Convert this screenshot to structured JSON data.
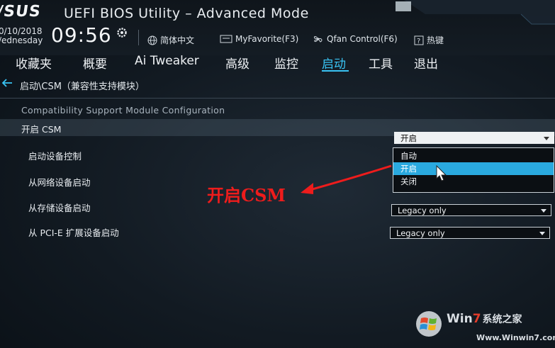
{
  "header": {
    "logo_text": "/SUS",
    "title": "UEFI BIOS Utility – Advanced Mode",
    "date": "0/10/2018",
    "weekday": "/ednesday",
    "time": "09:56",
    "tools": [
      {
        "label": "简体中文",
        "icon": "globe-icon"
      },
      {
        "label": "MyFavorite(F3)",
        "icon": "favorite-icon"
      },
      {
        "label": "Qfan Control(F6)",
        "icon": "fan-icon"
      },
      {
        "label": "热键",
        "icon": "help-icon"
      }
    ]
  },
  "nav": {
    "tabs": [
      "收藏夹",
      "概要",
      "Ai Tweaker",
      "高级",
      "监控",
      "启动",
      "工具",
      "退出"
    ],
    "active": "启动"
  },
  "breadcrumb": "启动\\CSM（兼容性支持模块）",
  "section_title": "Compatibility Support Module Configuration",
  "settings": [
    {
      "label": "开启 CSM",
      "value": "开启",
      "highlighted": true
    },
    {
      "label": "启动设备控制",
      "value": ""
    },
    {
      "label": "从网络设备启动",
      "value": ""
    },
    {
      "label": "从存储设备启动",
      "value": "Legacy only"
    },
    {
      "label": "从 PCI-E 扩展设备启动",
      "value": "Legacy only"
    }
  ],
  "dropdown_options": [
    "自动",
    "开启",
    "关闭"
  ],
  "dropdown_selected": "开启",
  "annotation": "开启CSM",
  "watermark": {
    "brand_win": "Win",
    "brand_7": "7",
    "brand_cn": "系统之家",
    "url": "Www.Winwin7.com"
  },
  "colors": {
    "accent": "#39c3f3",
    "selection": "#2aa9df",
    "annotation": "#ee1c1c"
  }
}
